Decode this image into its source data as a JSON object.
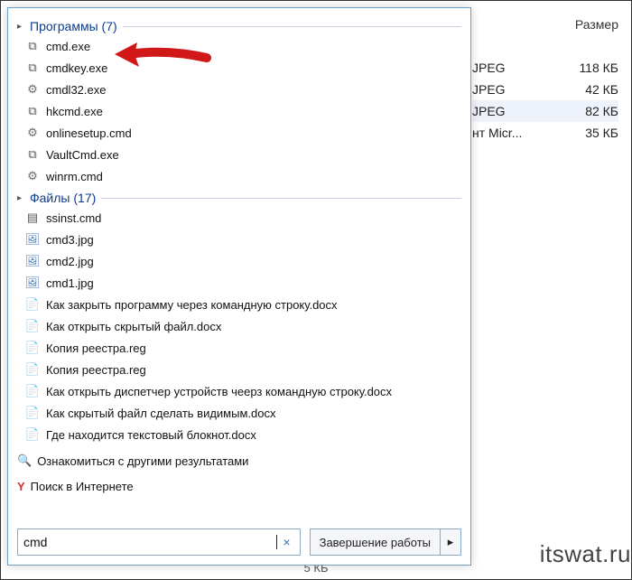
{
  "bg": {
    "header_size": "Размер",
    "rows": [
      {
        "type": "JPEG",
        "size": "118 КБ",
        "sel": false
      },
      {
        "type": "JPEG",
        "size": "42 КБ",
        "sel": false
      },
      {
        "type": "JPEG",
        "size": "82 КБ",
        "sel": true
      },
      {
        "type": "нт Micr...",
        "size": "35 КБ",
        "sel": false
      }
    ],
    "status": "5 КБ"
  },
  "watermark": "itswat.ru",
  "panel": {
    "group_programs": {
      "label": "Программы",
      "count": "(7)"
    },
    "programs": [
      {
        "icon": "exe",
        "name": "cmd.exe",
        "highlight": true
      },
      {
        "icon": "exe",
        "name": "cmdkey.exe"
      },
      {
        "icon": "gear",
        "name": "cmdl32.exe"
      },
      {
        "icon": "exe",
        "name": "hkcmd.exe"
      },
      {
        "icon": "gear",
        "name": "onlinesetup.cmd"
      },
      {
        "icon": "exe",
        "name": "VaultCmd.exe"
      },
      {
        "icon": "gear",
        "name": "winrm.cmd"
      }
    ],
    "group_files": {
      "label": "Файлы",
      "count": "(17)"
    },
    "files": [
      {
        "icon": "cmd",
        "name": "ssinst.cmd"
      },
      {
        "icon": "jpg",
        "name": "cmd3.jpg"
      },
      {
        "icon": "jpg",
        "name": "cmd2.jpg"
      },
      {
        "icon": "jpg",
        "name": "cmd1.jpg"
      },
      {
        "icon": "docx",
        "name": "Как закрыть программу через командную строку.docx"
      },
      {
        "icon": "docx",
        "name": "Как открыть скрытый файл.docx"
      },
      {
        "icon": "reg",
        "name": "Копия реестра.reg"
      },
      {
        "icon": "reg",
        "name": "Копия реестра.reg"
      },
      {
        "icon": "docx",
        "name": "Как открыть диспетчер устройств чеерз командную строку.docx"
      },
      {
        "icon": "docx",
        "name": "Как скрытый файл сделать видимым.docx"
      },
      {
        "icon": "docx",
        "name": "Где находится текстовый блокнот.docx"
      }
    ],
    "more_results": "Ознакомиться с другими результатами",
    "internet_search": "Поиск в Интернете",
    "search_value": "cmd",
    "clear": "×",
    "shutdown": "Завершение работы",
    "shutdown_arrow": "▸"
  },
  "icons": {
    "exe": "⧉",
    "gear": "⚙",
    "cmd": "▤",
    "jpg": "🖼",
    "docx": "📄",
    "reg": "📄",
    "search": "🔍",
    "ya": "Y",
    "arrow_right": "▸",
    "collapse": "▸"
  }
}
